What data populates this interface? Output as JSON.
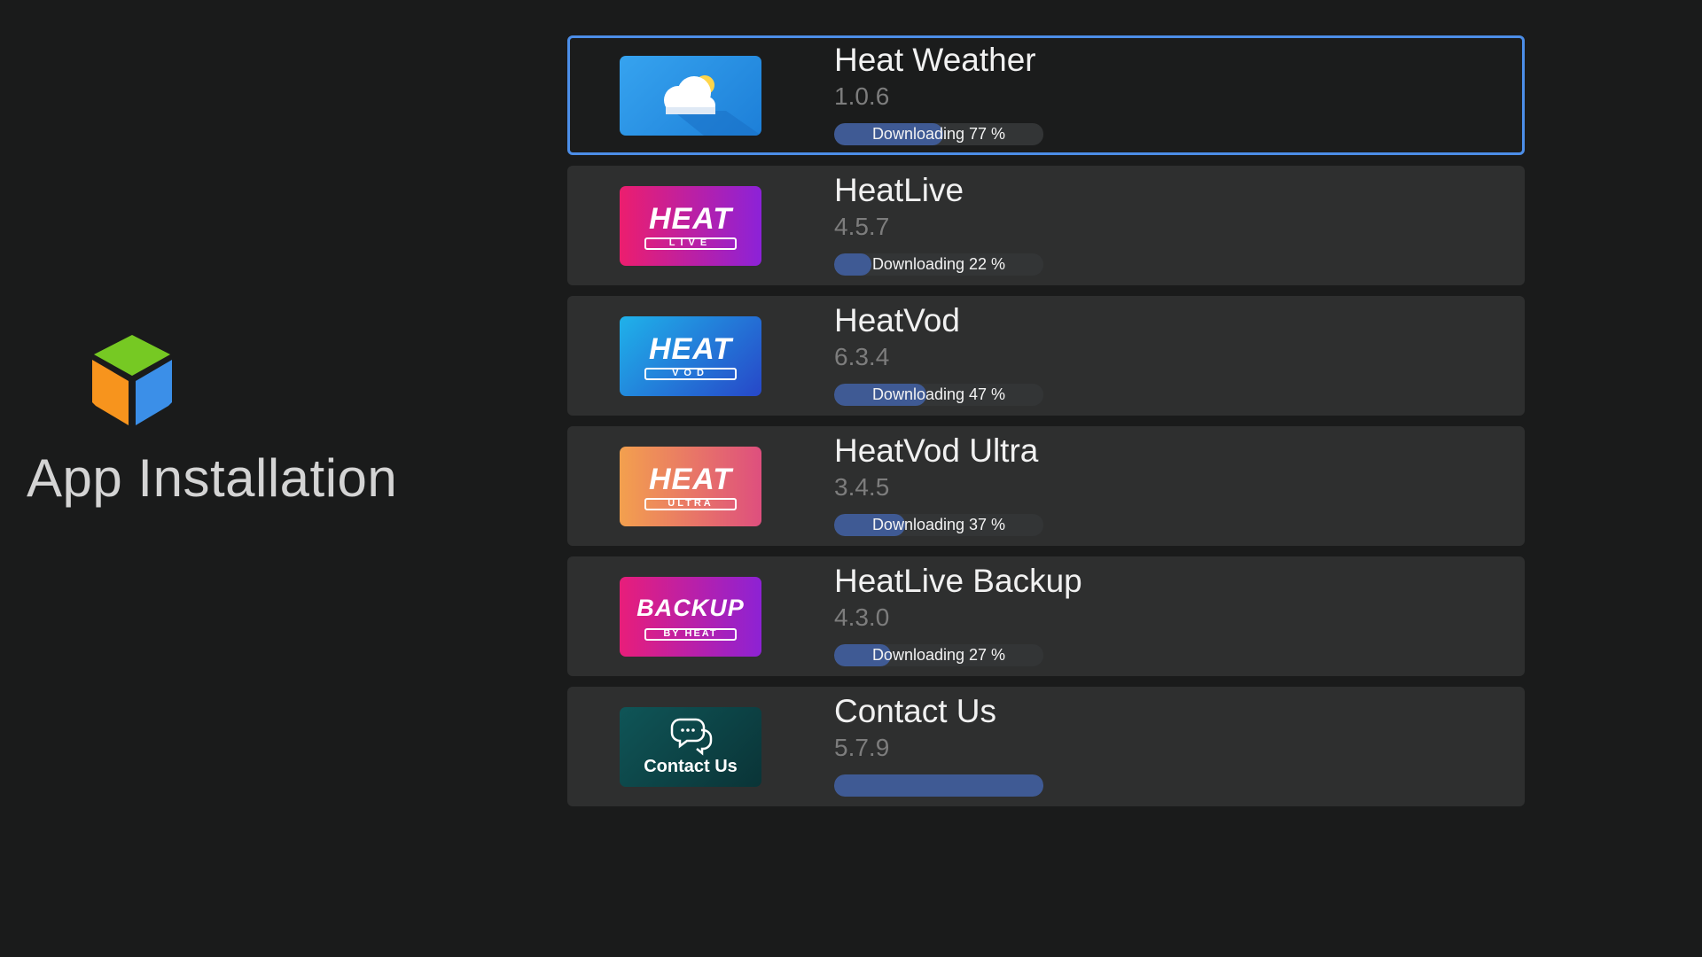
{
  "page": {
    "title": "App Installation",
    "logo_icon": "cube-icon"
  },
  "apps": [
    {
      "name": "Heat Weather",
      "version": "1.0.6",
      "status": "Downloading 77 %",
      "progress": 0.52,
      "icon": "weather-cloud-icon",
      "selected": true
    },
    {
      "name": "HeatLive",
      "version": "4.5.7",
      "status": "Downloading 22 %",
      "progress": 0.18,
      "icon": "heat-live-logo",
      "icon_text": "HEAT",
      "icon_subtext": "LIVE",
      "selected": false
    },
    {
      "name": "HeatVod",
      "version": "6.3.4",
      "status": "Downloading 47 %",
      "progress": 0.44,
      "icon": "heat-vod-logo",
      "icon_text": "HEAT",
      "icon_subtext": "VOD",
      "selected": false
    },
    {
      "name": "HeatVod Ultra",
      "version": "3.4.5",
      "status": "Downloading 37 %",
      "progress": 0.34,
      "icon": "heat-ultra-logo",
      "icon_text": "HEAT",
      "icon_subtext": "ULTRA",
      "selected": false
    },
    {
      "name": "HeatLive Backup",
      "version": "4.3.0",
      "status": "Downloading 27 %",
      "progress": 0.27,
      "icon": "backup-by-heat-logo",
      "icon_text": "BACKUP",
      "icon_subtext": "BY HEAT",
      "selected": false
    },
    {
      "name": "Contact Us",
      "version": "5.7.9",
      "status": "",
      "progress": 1.0,
      "icon": "chat-bubbles-icon",
      "icon_text": "Contact Us",
      "selected": false
    }
  ],
  "colors": {
    "background": "#1a1b1b",
    "row": "#2e2f2f",
    "selected_border": "#4c8ee8",
    "progress_fill": "#3f5a94",
    "progress_track": "#333536"
  }
}
